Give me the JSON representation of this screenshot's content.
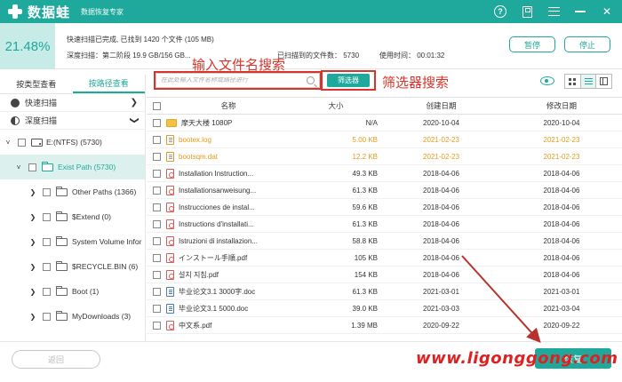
{
  "app": {
    "logo_text": "数据蛙",
    "subtitle": "数据恢复专家"
  },
  "status": {
    "percent": "21.48%",
    "line1": "快速扫描已完成, 已找到 1420 个文件 (105 MB)",
    "line2": "深度扫描：第二阶段 19.9 GB/156 GB...",
    "found_label": "已扫描到的文件数：",
    "found_value": "5730",
    "time_label": "使用时间：",
    "time_value": "00:01:32",
    "pause_label": "暂停",
    "stop_label": "停止"
  },
  "tabs": [
    {
      "label": "按类型查看"
    },
    {
      "label": "按路径查看"
    }
  ],
  "modes": [
    {
      "label": "快速扫描"
    },
    {
      "label": "深度扫描"
    }
  ],
  "tree": [
    {
      "label": "E:(NTFS) (5730)"
    },
    {
      "label": "Exist Path (5730)"
    },
    {
      "label": "Other Paths (1366)"
    },
    {
      "label": "$Extend (0)"
    },
    {
      "label": "System Volume Infor"
    },
    {
      "label": "$RECYCLE.BIN (6)"
    },
    {
      "label": "Boot (1)"
    },
    {
      "label": "MyDownloads (3)"
    }
  ],
  "toolbar": {
    "search_placeholder": "在此处输入文件名称或路径进行",
    "filter_label": "筛选器",
    "annot_search": "输入文件名搜索",
    "annot_filter": "筛选器搜索"
  },
  "table": {
    "headers": {
      "name": "名称",
      "size": "大小",
      "created": "创建日期",
      "modified": "修改日期"
    },
    "rows": [
      {
        "name": "摩天大楼 1080P",
        "size": "N/A",
        "created": "2020-10-04",
        "modified": "2020-10-04",
        "icon": "folder",
        "orange": false
      },
      {
        "name": "bootex.log",
        "size": "5.00 KB",
        "created": "2021-02-23",
        "modified": "2021-02-23",
        "icon": "txt",
        "orange": true
      },
      {
        "name": "bootsqm.dat",
        "size": "12.2 KB",
        "created": "2021-02-23",
        "modified": "2021-02-23",
        "icon": "txt",
        "orange": true
      },
      {
        "name": "Installation Instruction...",
        "size": "49.3 KB",
        "created": "2018-04-06",
        "modified": "2018-04-06",
        "icon": "pdf",
        "orange": false
      },
      {
        "name": "Installationsanweisung...",
        "size": "61.3 KB",
        "created": "2018-04-06",
        "modified": "2018-04-06",
        "icon": "pdf",
        "orange": false
      },
      {
        "name": "Instrucciones de instal...",
        "size": "59.6 KB",
        "created": "2018-04-06",
        "modified": "2018-04-06",
        "icon": "pdf",
        "orange": false
      },
      {
        "name": "Instructions d'installati...",
        "size": "61.3 KB",
        "created": "2018-04-06",
        "modified": "2018-04-06",
        "icon": "pdf",
        "orange": false
      },
      {
        "name": "Istruzioni di installazion...",
        "size": "58.8 KB",
        "created": "2018-04-06",
        "modified": "2018-04-06",
        "icon": "pdf",
        "orange": false
      },
      {
        "name": "インストール手順.pdf",
        "size": "105 KB",
        "created": "2018-04-06",
        "modified": "2018-04-06",
        "icon": "pdf",
        "orange": false
      },
      {
        "name": "설치 지침.pdf",
        "size": "154 KB",
        "created": "2018-04-06",
        "modified": "2018-04-06",
        "icon": "pdf",
        "orange": false
      },
      {
        "name": "毕业论文3.1 3000字.doc",
        "size": "61.3 KB",
        "created": "2021-03-01",
        "modified": "2021-03-01",
        "icon": "doc",
        "orange": false
      },
      {
        "name": "毕业论文3.1 5000.doc",
        "size": "39.0 KB",
        "created": "2021-03-03",
        "modified": "2021-03-04",
        "icon": "doc",
        "orange": false
      },
      {
        "name": "中文系.pdf",
        "size": "1.39 MB",
        "created": "2020-09-22",
        "modified": "2020-09-22",
        "icon": "pdf",
        "orange": false
      }
    ]
  },
  "bottom": {
    "back_label": "返回",
    "recover_label": "恢复",
    "watermark": "www.ligonggong.com"
  },
  "colors": {
    "accent": "#1fa99d",
    "annotation": "#d9342b",
    "deleted_file": "#e49a1b"
  }
}
